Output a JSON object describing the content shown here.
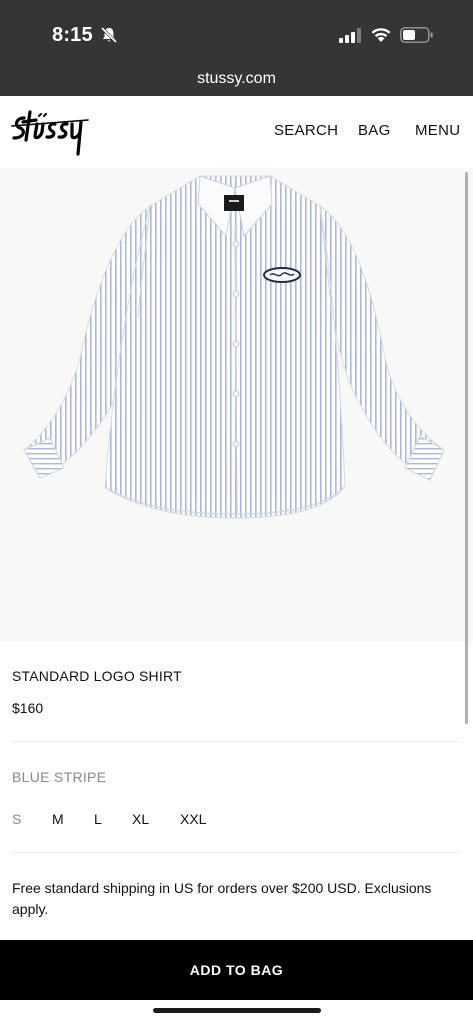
{
  "status_bar": {
    "time": "8:15",
    "icons": [
      "bell-slash-icon",
      "signal-icon",
      "wifi-icon",
      "battery-icon"
    ]
  },
  "browser": {
    "url": "stussy.com"
  },
  "header": {
    "logo_text": "Stüssy",
    "nav": {
      "search": "SEARCH",
      "bag": "BAG",
      "menu": "MENU"
    }
  },
  "product": {
    "name": "STANDARD LOGO SHIRT",
    "price": "$160",
    "color": "BLUE STRIPE",
    "sizes": [
      {
        "label": "S",
        "available": false
      },
      {
        "label": "M",
        "available": true
      },
      {
        "label": "L",
        "available": true
      },
      {
        "label": "XL",
        "available": true
      },
      {
        "label": "XXL",
        "available": true
      }
    ],
    "shipping_note": "Free standard shipping in US for orders over $200 USD. Exclusions apply.",
    "add_to_bag": "ADD TO BAG"
  },
  "colors": {
    "status_bar_bg": "#333536",
    "button_bg": "#000000",
    "muted_text": "#8a8a8a",
    "shirt_stripe": "#aab9dc"
  }
}
